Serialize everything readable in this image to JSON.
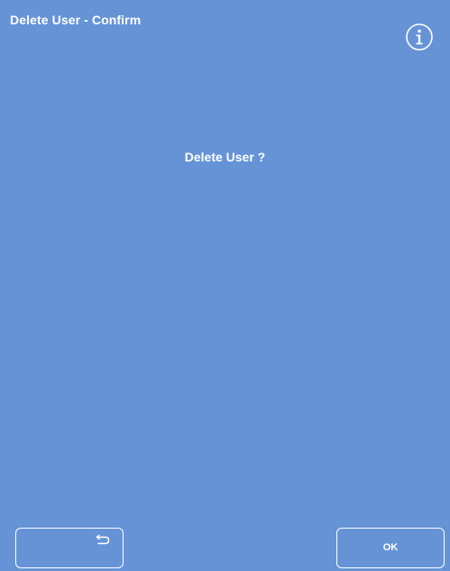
{
  "header": {
    "title": "Delete User - Confirm",
    "info_icon": "info-icon"
  },
  "dialog": {
    "message": "Delete User ?"
  },
  "footer": {
    "back_icon": "back-arrow-icon",
    "ok_label": "OK"
  },
  "colors": {
    "background": "#6593d6",
    "text": "#ffffff",
    "button_border": "#ffffff"
  }
}
